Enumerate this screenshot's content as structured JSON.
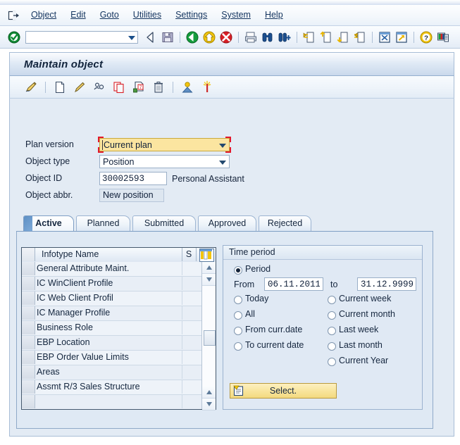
{
  "menubar": {
    "exit_icon": "exit-box-icon",
    "items": [
      {
        "label": "Object",
        "accel": "O"
      },
      {
        "label": "Edit",
        "accel": "E"
      },
      {
        "label": "Goto",
        "accel": "G"
      },
      {
        "label": "Utilities",
        "accel": "U"
      },
      {
        "label": "Settings",
        "accel": "S"
      },
      {
        "label": "System",
        "accel": "y"
      },
      {
        "label": "Help",
        "accel": "H"
      }
    ]
  },
  "toolbar": {
    "command_value": "",
    "command_placeholder": "",
    "icons": [
      "enter-check-icon",
      "back-arrow-icon",
      "save-disk-icon",
      "back-green-icon",
      "exit-yellow-icon",
      "cancel-red-icon",
      "print-icon",
      "find-icon",
      "find-next-icon",
      "first-page-icon",
      "previous-page-icon",
      "next-page-icon",
      "last-page-icon",
      "new-session-icon",
      "create-shortcut-icon",
      "help-icon",
      "customize-layout-icon"
    ]
  },
  "window": {
    "title": "Maintain object",
    "app_toolbar_icons": [
      "overview-pencil-icon",
      "create-icon",
      "change-icon",
      "display-icon",
      "copy-icon",
      "delimit-icon",
      "delete-icon",
      "person-icon",
      "sparkle-icon"
    ]
  },
  "form": {
    "fields": [
      {
        "label": "Plan version",
        "value": "Current plan",
        "type": "dropdown",
        "focused": true
      },
      {
        "label": "Object type",
        "value": "Position",
        "type": "dropdown",
        "focused": false
      },
      {
        "label": "Object ID",
        "value": "30002593",
        "type": "text",
        "side_text": "Personal Assistant"
      },
      {
        "label": "Object abbr.",
        "value": "New position",
        "type": "readonly"
      }
    ]
  },
  "tabs": {
    "items": [
      {
        "label": "Active",
        "selected": true
      },
      {
        "label": "Planned",
        "selected": false
      },
      {
        "label": "Submitted",
        "selected": false
      },
      {
        "label": "Approved",
        "selected": false
      },
      {
        "label": "Rejected",
        "selected": false
      }
    ]
  },
  "infotype_table": {
    "columns": [
      "",
      "Infotype Name",
      "S",
      ""
    ],
    "config_icon": "column-config-icon",
    "rows": [
      {
        "name": "General Attribute Maint.",
        "s": ""
      },
      {
        "name": "IC WinClient Profile",
        "s": ""
      },
      {
        "name": "IC Web Client Profil",
        "s": ""
      },
      {
        "name": "IC Manager Profile",
        "s": ""
      },
      {
        "name": "Business Role",
        "s": ""
      },
      {
        "name": "EBP Location",
        "s": ""
      },
      {
        "name": "EBP Order Value Limits",
        "s": ""
      },
      {
        "name": "Areas",
        "s": ""
      },
      {
        "name": "Assmt R/3 Sales Structure",
        "s": ""
      },
      {
        "name": "",
        "s": ""
      }
    ]
  },
  "time_period": {
    "title": "Time period",
    "period_label": "Period",
    "period_selected": true,
    "from_label": "From",
    "from_value": "06.11.2011",
    "to_label": "to",
    "to_value": "31.12.9999",
    "options_left": [
      {
        "label": "Today",
        "selected": false
      },
      {
        "label": "All",
        "selected": false
      },
      {
        "label": "From curr.date",
        "selected": false
      },
      {
        "label": "To current date",
        "selected": false
      }
    ],
    "options_right": [
      {
        "label": "Current week",
        "selected": false
      },
      {
        "label": "Current month",
        "selected": false
      },
      {
        "label": "Last week",
        "selected": false
      },
      {
        "label": "Last month",
        "selected": false
      },
      {
        "label": "Current Year",
        "selected": false
      }
    ],
    "select_button": {
      "label": "Select.",
      "icon": "select-list-icon"
    }
  },
  "colors": {
    "focus_yellow": "#fbe5a0",
    "focus_red": "#e2192c",
    "panel_bg": "#e3ebf4",
    "tab_selected_flag": "#5d8fc4",
    "button_yellow": "#f8e49a"
  }
}
